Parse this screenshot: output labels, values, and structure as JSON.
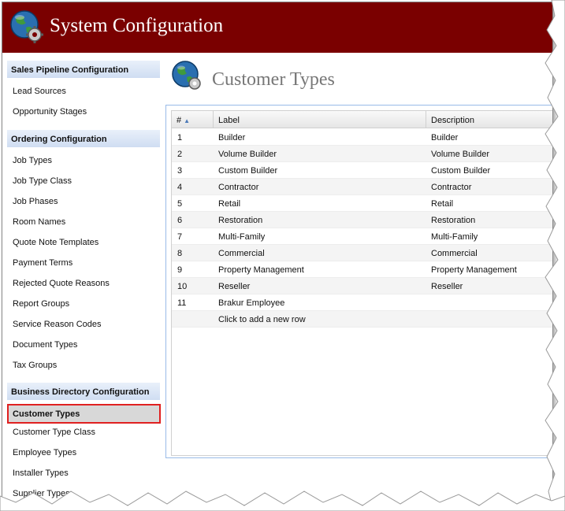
{
  "app": {
    "title": "System Configuration"
  },
  "sidebar": {
    "sections": [
      {
        "header": "Sales Pipeline Configuration",
        "items": [
          "Lead Sources",
          "Opportunity Stages"
        ]
      },
      {
        "header": "Ordering Configuration",
        "items": [
          "Job Types",
          "Job Type Class",
          "Job Phases",
          "Room Names",
          "Quote Note Templates",
          "Payment Terms",
          "Rejected Quote Reasons",
          "Report Groups",
          "Service Reason Codes",
          "Document Types",
          "Tax Groups"
        ]
      },
      {
        "header": "Business Directory Configuration",
        "items": [
          "Customer Types",
          "Customer Type Class",
          "Employee Types",
          "Installer Types",
          "Supplier Types"
        ]
      }
    ],
    "selected": "Customer Types"
  },
  "page": {
    "title": "Customer Types",
    "grid": {
      "columns": [
        "#",
        "Label",
        "Description"
      ],
      "sort": {
        "column": "#",
        "direction": "ascending"
      },
      "rows": [
        {
          "num": "1",
          "label": "Builder",
          "description": "Builder"
        },
        {
          "num": "2",
          "label": "Volume Builder",
          "description": "Volume Builder"
        },
        {
          "num": "3",
          "label": "Custom Builder",
          "description": "Custom Builder"
        },
        {
          "num": "4",
          "label": "Contractor",
          "description": "Contractor"
        },
        {
          "num": "5",
          "label": "Retail",
          "description": "Retail"
        },
        {
          "num": "6",
          "label": "Restoration",
          "description": "Restoration"
        },
        {
          "num": "7",
          "label": "Multi-Family",
          "description": "Multi-Family"
        },
        {
          "num": "8",
          "label": "Commercial",
          "description": "Commercial"
        },
        {
          "num": "9",
          "label": "Property Management",
          "description": "Property Management"
        },
        {
          "num": "10",
          "label": "Reseller",
          "description": "Reseller"
        },
        {
          "num": "11",
          "label": "Brakur Employee",
          "description": ""
        }
      ],
      "add_row_label": "Click to add a new row"
    }
  },
  "icons": {
    "header_logo": "globe-gear-icon",
    "page_icon": "globe-gear-icon",
    "sort": "sort-ascending-icon"
  },
  "colors": {
    "header_bg": "#7a0000",
    "section_header": "#cfddf2",
    "selection_border": "#e02020",
    "panel_border": "#99bbe8"
  }
}
